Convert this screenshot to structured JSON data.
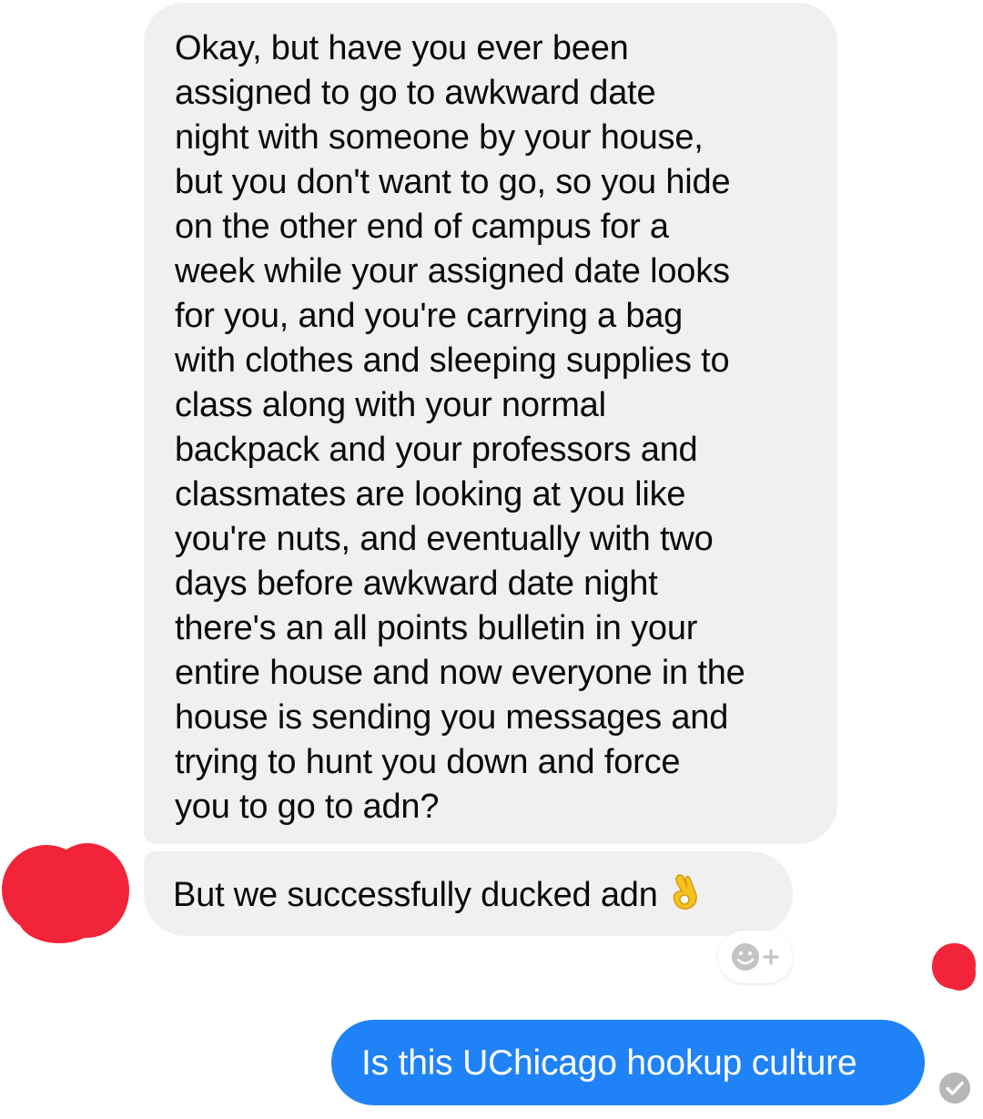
{
  "conversation": {
    "incoming_messages": [
      {
        "text": "Okay, but have you ever been\nassigned to go to awkward date\nnight with someone by your house,\nbut you don't want to go, so you hide\non the other end of campus for a\nweek while your assigned date looks\nfor you, and you're carrying a bag\nwith clothes and sleeping supplies to\nclass along with your normal\nbackpack and your professors and\nclassmates are looking at you like\nyou're nuts, and eventually with two\ndays before awkward date night\nthere's an all points bulletin in your\nentire house and now everyone in the\nhouse is sending you messages and\ntrying to hunt you down and force\nyou to go to adn?"
      },
      {
        "text": "But we successfully ducked adn",
        "emoji": "ok-hand-icon"
      }
    ],
    "outgoing_messages": [
      {
        "text": "Is this UChicago hookup culture"
      }
    ]
  },
  "colors": {
    "incoming_bubble": "#f0f0f0",
    "outgoing_bubble": "#1f82f7",
    "redaction": "#f2243a",
    "sent_check": "#b7b7b7"
  },
  "icons": {
    "reaction": "add-reaction-icon",
    "status": "sent-check-icon"
  }
}
